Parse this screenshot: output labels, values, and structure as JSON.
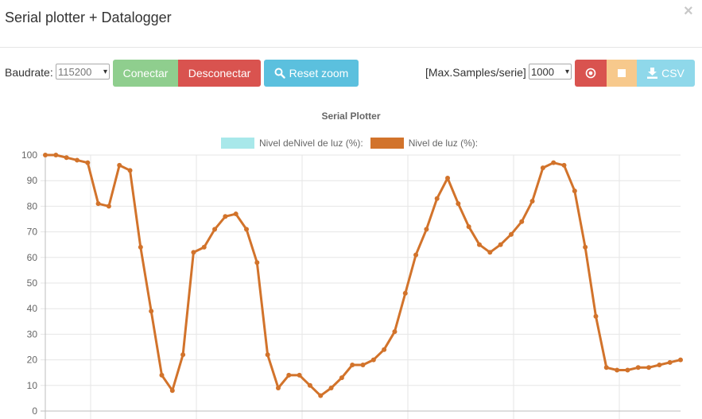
{
  "header": {
    "title": "Serial plotter + Datalogger"
  },
  "toolbar": {
    "baud_label": "Baudrate:",
    "baud_value": "115200",
    "connect_label": "Conectar",
    "disconnect_label": "Desconectar",
    "reset_zoom_label": "Reset zoom",
    "max_samples_label": "[Max.Samples/serie]",
    "max_samples_value": "1000",
    "csv_label": "CSV"
  },
  "colors": {
    "connect": "#8fce8e",
    "disconnect": "#d9534f",
    "reset": "#5bc0de",
    "record": "#d9534f",
    "stop": "#f7c98c",
    "csv": "#8fd8ea",
    "series1": "#a8e8ea",
    "series2": "#d2732b"
  },
  "chart_data": {
    "type": "line",
    "title": "Serial Plotter",
    "legend": [
      "Nivel deNivel de luz (%):",
      "Nivel de luz (%):"
    ],
    "ylim": [
      0,
      100
    ],
    "yticks": [
      0,
      10,
      20,
      30,
      40,
      50,
      60,
      70,
      80,
      90,
      100
    ],
    "grid": true,
    "series": [
      {
        "name": "Nivel deNivel de luz (%):",
        "values": []
      },
      {
        "name": "Nivel de luz (%):",
        "values": [
          100,
          100,
          99,
          98,
          97,
          81,
          80,
          96,
          94,
          64,
          39,
          14,
          8,
          22,
          62,
          64,
          71,
          76,
          77,
          71,
          58,
          22,
          9,
          14,
          14,
          10,
          6,
          9,
          13,
          18,
          18,
          20,
          24,
          31,
          46,
          61,
          71,
          83,
          91,
          81,
          72,
          65,
          62,
          65,
          69,
          74,
          82,
          95,
          97,
          96,
          86,
          64,
          37,
          17,
          16,
          16,
          17,
          17,
          18,
          19,
          20
        ]
      }
    ]
  }
}
